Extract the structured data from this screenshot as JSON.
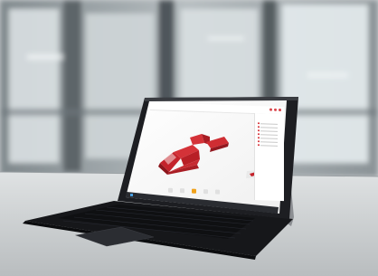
{
  "scene": {
    "description_colors": {
      "wall": "#9ea6aa",
      "window_light": "#e9eef0",
      "table": "#c9ccce",
      "device_body": "#1c1d21",
      "screen_bg": "#f6f6f6",
      "accent": "#d4262d",
      "keyboard": "#141518",
      "kickstand": "#8f9296"
    }
  },
  "app": {
    "logo_text": "",
    "header_icons": [
      "notifications-icon",
      "help-icon",
      "user-icon"
    ],
    "side_panel": {
      "title": "",
      "items": [
        "",
        "",
        "",
        "",
        "",
        "",
        ""
      ]
    },
    "toolbar": {
      "buttons": [
        "select-tool-icon",
        "move-tool-icon",
        "section-tool-icon",
        "measure-tool-icon",
        "view-tool-icon"
      ],
      "active_index": 2
    }
  }
}
